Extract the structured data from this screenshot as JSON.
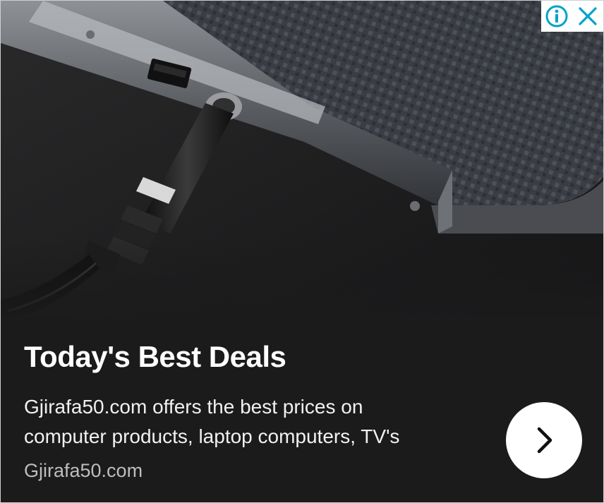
{
  "ad": {
    "headline": "Today's Best Deals",
    "body_lines": [
      "Gjirafa50.com offers the best prices on",
      "computer products, laptop computers, TV's"
    ],
    "domain": "Gjirafa50.com",
    "colors": {
      "background": "#1b1b1c",
      "controls_accent": "#00a3c9",
      "headline": "#ffffff",
      "domain_text": "#bdbdbd"
    },
    "icons": {
      "info": "info-icon",
      "close": "close-icon",
      "cta": "chevron-right-icon"
    }
  }
}
